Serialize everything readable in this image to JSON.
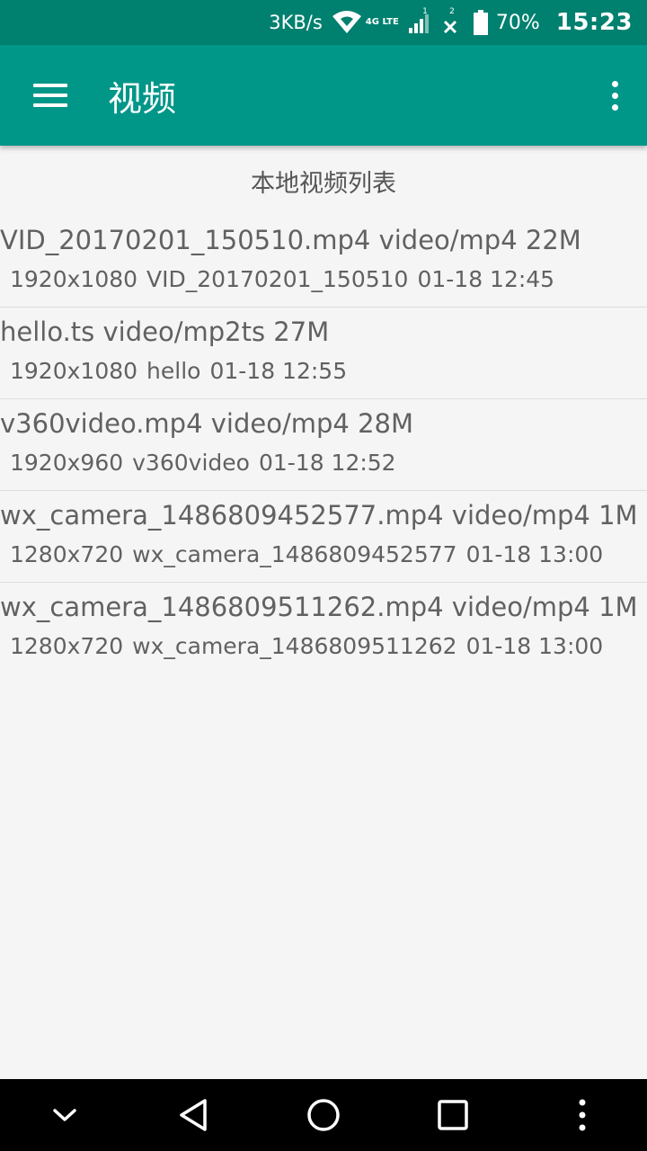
{
  "status_bar": {
    "speed": "3KB/s",
    "network_label": "4G LTE",
    "sim1": "1",
    "sim2": "2",
    "battery": "70%",
    "time": "15:23"
  },
  "app_bar": {
    "title": "视频",
    "menu_icon": "hamburger-menu-icon",
    "overflow_icon": "more-vert-icon"
  },
  "list": {
    "header": "本地视频列表",
    "items": [
      {
        "filename": "VID_20170201_150510.mp4",
        "mime": "video/mp4",
        "size": "22M",
        "resolution": "1920x1080",
        "title": "VID_20170201_150510",
        "date": "01-18 12:45"
      },
      {
        "filename": "hello.ts",
        "mime": "video/mp2ts",
        "size": "27M",
        "resolution": "1920x1080",
        "title": "hello",
        "date": "01-18 12:55"
      },
      {
        "filename": "v360video.mp4",
        "mime": "video/mp4",
        "size": "28M",
        "resolution": "1920x960",
        "title": "v360video",
        "date": "01-18 12:52"
      },
      {
        "filename": "wx_camera_1486809452577.mp4",
        "mime": "video/mp4",
        "size": "1M",
        "resolution": "1280x720",
        "title": "wx_camera_1486809452577",
        "date": "01-18 13:00"
      },
      {
        "filename": "wx_camera_1486809511262.mp4",
        "mime": "video/mp4",
        "size": "1M",
        "resolution": "1280x720",
        "title": "wx_camera_1486809511262",
        "date": "01-18 13:00"
      }
    ]
  },
  "nav_bar": {
    "icons": [
      "chevron-down-icon",
      "back-icon",
      "home-icon",
      "recents-icon",
      "more-vert-icon"
    ]
  },
  "colors": {
    "status_bar": "#00806f",
    "app_bar": "#009688",
    "background": "#f5f5f5",
    "text": "#616161"
  }
}
